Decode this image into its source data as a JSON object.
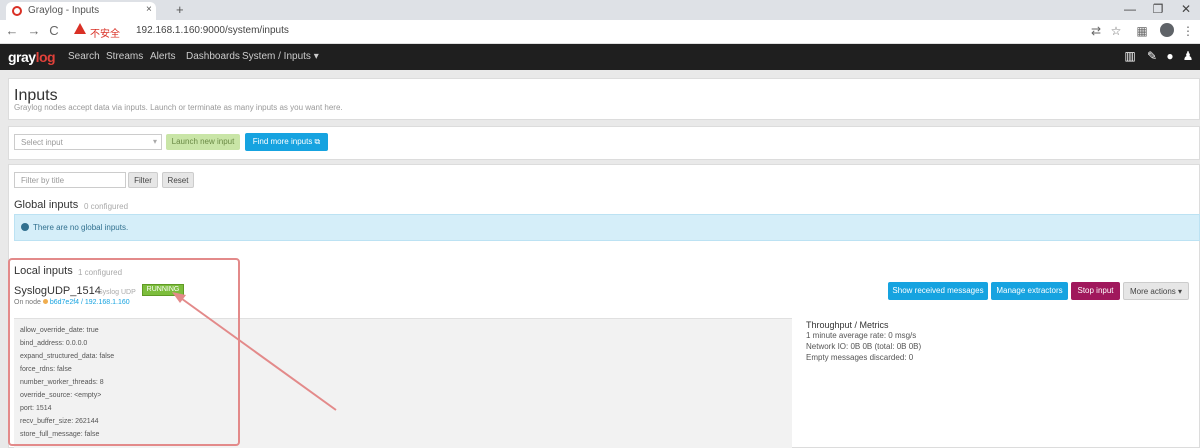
{
  "browser": {
    "tab_title": "Graylog - Inputs",
    "tab_close": "×",
    "new_tab": "+",
    "window_min": "—",
    "window_max": "❐",
    "window_close": "✕",
    "nav_back": "←",
    "nav_forward": "→",
    "nav_reload": "C",
    "insecure_label": "不安全",
    "url": "192.168.1.160:9000/system/inputs",
    "menu_dots": "⋮"
  },
  "navbar": {
    "logo_main": "gray",
    "logo_accent": "log",
    "items": [
      "Search",
      "Streams",
      "Alerts",
      "Dashboards",
      "System / Inputs ▾"
    ],
    "right_icons": [
      "chart-icon",
      "edit-icon",
      "help-icon",
      "user-icon"
    ]
  },
  "page": {
    "title": "Inputs",
    "description": "Graylog nodes accept data via inputs. Launch or terminate as many inputs as you want here."
  },
  "launch": {
    "select_placeholder": "Select input",
    "launch_button": "Launch new input",
    "marketplace_button": "Find more inputs ⧉"
  },
  "filter": {
    "placeholder": "Filter by title",
    "filter_button": "Filter",
    "reset_button": "Reset"
  },
  "global_inputs": {
    "title": "Global inputs",
    "subtitle": "0 configured",
    "info_text": "There are no global inputs."
  },
  "local_inputs": {
    "title": "Local inputs",
    "subtitle": "1 configured",
    "input_name": "SyslogUDP_1514",
    "input_type": "Syslog UDP",
    "status": "RUNNING",
    "on_node_label": "On node",
    "node_link": "b6d7e2f4 / 192.168.1.160",
    "buttons": [
      "Show received messages",
      "Manage extractors",
      "Stop input",
      "More actions ▾"
    ],
    "config": [
      "allow_override_date: true",
      "bind_address: 0.0.0.0",
      "expand_structured_data: false",
      "force_rdns: false",
      "number_worker_threads: 8",
      "override_source: <empty>",
      "port: 1514",
      "recv_buffer_size: 262144",
      "store_full_message: false"
    ],
    "stats": [
      "Throughput / Metrics",
      "1 minute average rate: 0 msg/s",
      "Network IO: 0B 0B (total: 0B 0B)",
      "Empty messages discarded: 0"
    ]
  }
}
